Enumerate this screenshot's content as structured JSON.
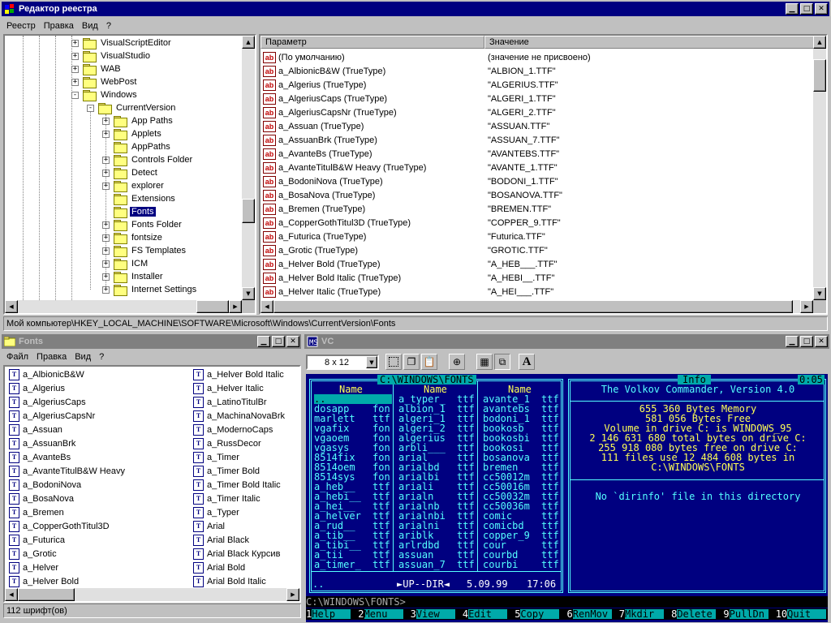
{
  "regedit": {
    "title": "Редактор реестра",
    "menu": [
      "Реестр",
      "Правка",
      "Вид",
      "?"
    ],
    "tree": [
      {
        "label": "VisualScriptEditor",
        "expand": "+",
        "level": 0,
        "selected": false,
        "open": false
      },
      {
        "label": "VisualStudio",
        "expand": "+",
        "level": 0,
        "selected": false,
        "open": false
      },
      {
        "label": "WAB",
        "expand": "+",
        "level": 0,
        "selected": false,
        "open": false
      },
      {
        "label": "WebPost",
        "expand": "+",
        "level": 0,
        "selected": false,
        "open": false
      },
      {
        "label": "Windows",
        "expand": "-",
        "level": 0,
        "selected": false,
        "open": true
      },
      {
        "label": "CurrentVersion",
        "expand": "-",
        "level": 1,
        "selected": false,
        "open": true
      },
      {
        "label": "App Paths",
        "expand": "+",
        "level": 2,
        "selected": false,
        "open": false
      },
      {
        "label": "Applets",
        "expand": "+",
        "level": 2,
        "selected": false,
        "open": false
      },
      {
        "label": "AppPaths",
        "expand": "",
        "level": 2,
        "selected": false,
        "open": false
      },
      {
        "label": "Controls Folder",
        "expand": "+",
        "level": 2,
        "selected": false,
        "open": false
      },
      {
        "label": "Detect",
        "expand": "+",
        "level": 2,
        "selected": false,
        "open": false
      },
      {
        "label": "explorer",
        "expand": "+",
        "level": 2,
        "selected": false,
        "open": false
      },
      {
        "label": "Extensions",
        "expand": "",
        "level": 2,
        "selected": false,
        "open": false
      },
      {
        "label": "Fonts",
        "expand": "",
        "level": 2,
        "selected": true,
        "open": true
      },
      {
        "label": "Fonts Folder",
        "expand": "+",
        "level": 2,
        "selected": false,
        "open": false
      },
      {
        "label": "fontsize",
        "expand": "+",
        "level": 2,
        "selected": false,
        "open": false
      },
      {
        "label": "FS Templates",
        "expand": "+",
        "level": 2,
        "selected": false,
        "open": false
      },
      {
        "label": "ICM",
        "expand": "+",
        "level": 2,
        "selected": false,
        "open": false
      },
      {
        "label": "Installer",
        "expand": "+",
        "level": 2,
        "selected": false,
        "open": false
      },
      {
        "label": "Internet Settings",
        "expand": "+",
        "level": 2,
        "selected": false,
        "open": false
      }
    ],
    "columns": {
      "name": "Параметр",
      "value": "Значение"
    },
    "values": [
      {
        "name": "(По умолчанию)",
        "value": "(значение не присвоено)"
      },
      {
        "name": "a_AlbionicB&W (TrueType)",
        "value": "\"ALBION_1.TTF\""
      },
      {
        "name": "a_Algerius (TrueType)",
        "value": "\"ALGERIUS.TTF\""
      },
      {
        "name": "a_AlgeriusCaps (TrueType)",
        "value": "\"ALGERI_1.TTF\""
      },
      {
        "name": "a_AlgeriusCapsNr (TrueType)",
        "value": "\"ALGERI_2.TTF\""
      },
      {
        "name": "a_Assuan (TrueType)",
        "value": "\"ASSUAN.TTF\""
      },
      {
        "name": "a_AssuanBrk (TrueType)",
        "value": "\"ASSUAN_7.TTF\""
      },
      {
        "name": "a_AvanteBs (TrueType)",
        "value": "\"AVANTEBS.TTF\""
      },
      {
        "name": "a_AvanteTitulB&W Heavy (TrueType)",
        "value": "\"AVANTE_1.TTF\""
      },
      {
        "name": "a_BodoniNova (TrueType)",
        "value": "\"BODONI_1.TTF\""
      },
      {
        "name": "a_BosaNova (TrueType)",
        "value": "\"BOSANOVA.TTF\""
      },
      {
        "name": "a_Bremen (TrueType)",
        "value": "\"BREMEN.TTF\""
      },
      {
        "name": "a_CopperGothTitul3D (TrueType)",
        "value": "\"COPPER_9.TTF\""
      },
      {
        "name": "a_Futurica (TrueType)",
        "value": "\"Futurica.TTF\""
      },
      {
        "name": "a_Grotic (TrueType)",
        "value": "\"GROTIC.TTF\""
      },
      {
        "name": "a_Helver  Bold (TrueType)",
        "value": "\"A_HEB___.TTF\""
      },
      {
        "name": "a_Helver  Bold Italic (TrueType)",
        "value": "\"A_HEBI__.TTF\""
      },
      {
        "name": "a_Helver  Italic (TrueType)",
        "value": "\"A_HEI___.TTF\""
      }
    ],
    "statusbar": "Мой компьютер\\HKEY_LOCAL_MACHINE\\SOFTWARE\\Microsoft\\Windows\\CurrentVersion\\Fonts",
    "tree_scroll_fraction": 0.7,
    "values_scroll_fraction": 0.05
  },
  "fonts": {
    "title": "Fonts",
    "menu": [
      "Файл",
      "Правка",
      "Вид",
      "?"
    ],
    "col1": [
      "a_AlbionicB&W",
      "a_Algerius",
      "a_AlgeriusCaps",
      "a_AlgeriusCapsNr",
      "a_Assuan",
      "a_AssuanBrk",
      "a_AvanteBs",
      "a_AvanteTitulB&W Heavy",
      "a_BodoniNova",
      "a_BosaNova",
      "a_Bremen",
      "a_CopperGothTitul3D",
      "a_Futurica",
      "a_Grotic",
      "a_Helver",
      "a_Helver  Bold"
    ],
    "col2": [
      "a_Helver  Bold Italic",
      "a_Helver  Italic",
      "a_LatinoTitulBr",
      "a_MachinaNovaBrk",
      "a_ModernoCaps",
      "a_RussDecor",
      "a_Timer",
      "a_Timer  Bold",
      "a_Timer  Bold Italic",
      "a_Timer  Italic",
      "a_Typer",
      "Arial",
      "Arial Black",
      "Arial Black Курсив",
      "Arial Bold",
      "Arial Bold Italic"
    ],
    "status": "112 шрифт(ов)"
  },
  "vc": {
    "title": "VC",
    "font_size": "8 x 12",
    "left_path": "C:\\WINDOWS\\FONTS",
    "col_header": "Name",
    "col1": [
      "..",
      "dosapp",
      "marlett",
      "vgafix",
      "vgaoem",
      "vgasys",
      "8514fix",
      "8514oem",
      "8514sys",
      "a_heb__",
      "a_hebi__",
      "a_hei__",
      "a_helver",
      "a_rud__",
      "a_tib__",
      "a_tibi__",
      "a_tii",
      "a_timer_"
    ],
    "col1_ext": [
      "",
      "fon",
      "ttf",
      "fon",
      "fon",
      "fon",
      "fon",
      "fon",
      "fon",
      "ttf",
      "ttf",
      "ttf",
      "ttf",
      "ttf",
      "ttf",
      "ttf",
      "ttf",
      "ttf"
    ],
    "col2": [
      "a_typer_",
      "albion_1",
      "algeri_1",
      "algeri_2",
      "algerius",
      "arbli___",
      "arial",
      "arialbd",
      "arialbi",
      "ariali",
      "arialn",
      "arialnb",
      "arialnbi",
      "arialni",
      "ariblk",
      "arlrdbd",
      "assuan",
      "assuan_7"
    ],
    "col2_ext": [
      "ttf",
      "ttf",
      "ttf",
      "ttf",
      "ttf",
      "ttf",
      "ttf",
      "ttf",
      "ttf",
      "ttf",
      "ttf",
      "ttf",
      "ttf",
      "ttf",
      "ttf",
      "ttf",
      "ttf",
      "ttf"
    ],
    "col3": [
      "avante_1",
      "avantebs",
      "bodoni_1",
      "bookosb",
      "bookosbi",
      "bookosi",
      "bosanova",
      "bremen",
      "cc50012m",
      "cc50016m",
      "cc50032m",
      "cc50036m",
      "comic",
      "comicbd",
      "copper_9",
      "cour",
      "courbd",
      "courbi"
    ],
    "col3_ext": [
      "ttf",
      "ttf",
      "ttf",
      "ttf",
      "ttf",
      "ttf",
      "ttf",
      "ttf",
      "ttf",
      "ttf",
      "ttf",
      "ttf",
      "ttf",
      "ttf",
      "ttf",
      "ttf",
      "ttf",
      "ttf"
    ],
    "bottom_name": "..",
    "bottom_info": "►UP--DIR◄",
    "bottom_date": "5.09.99",
    "bottom_time": "17:06",
    "info_title": "Info",
    "clock": "0:05",
    "info_lines": [
      "The Volkov Commander, Version 4.0",
      "",
      "655 360 Bytes Memory",
      "581 056 Bytes Free",
      "Volume in drive C: is WINDOWS_95",
      "2 146 631 680 total bytes on drive C:",
      "255 918 080 bytes free on drive C:",
      "111 files use 12 484 608 bytes in",
      "C:\\WINDOWS\\FONTS",
      "",
      "",
      "No `dirinfo' file in this directory"
    ],
    "prompt": "C:\\WINDOWS\\FONTS>",
    "fkeys": [
      {
        "num": "1",
        "label": "Help"
      },
      {
        "num": "2",
        "label": "Menu"
      },
      {
        "num": "3",
        "label": "View"
      },
      {
        "num": "4",
        "label": "Edit"
      },
      {
        "num": "5",
        "label": "Copy"
      },
      {
        "num": "6",
        "label": "RenMov"
      },
      {
        "num": "7",
        "label": "Mkdir"
      },
      {
        "num": "8",
        "label": "Delete"
      },
      {
        "num": "9",
        "label": "PullDn"
      },
      {
        "num": "10",
        "label": "Quit"
      }
    ]
  }
}
